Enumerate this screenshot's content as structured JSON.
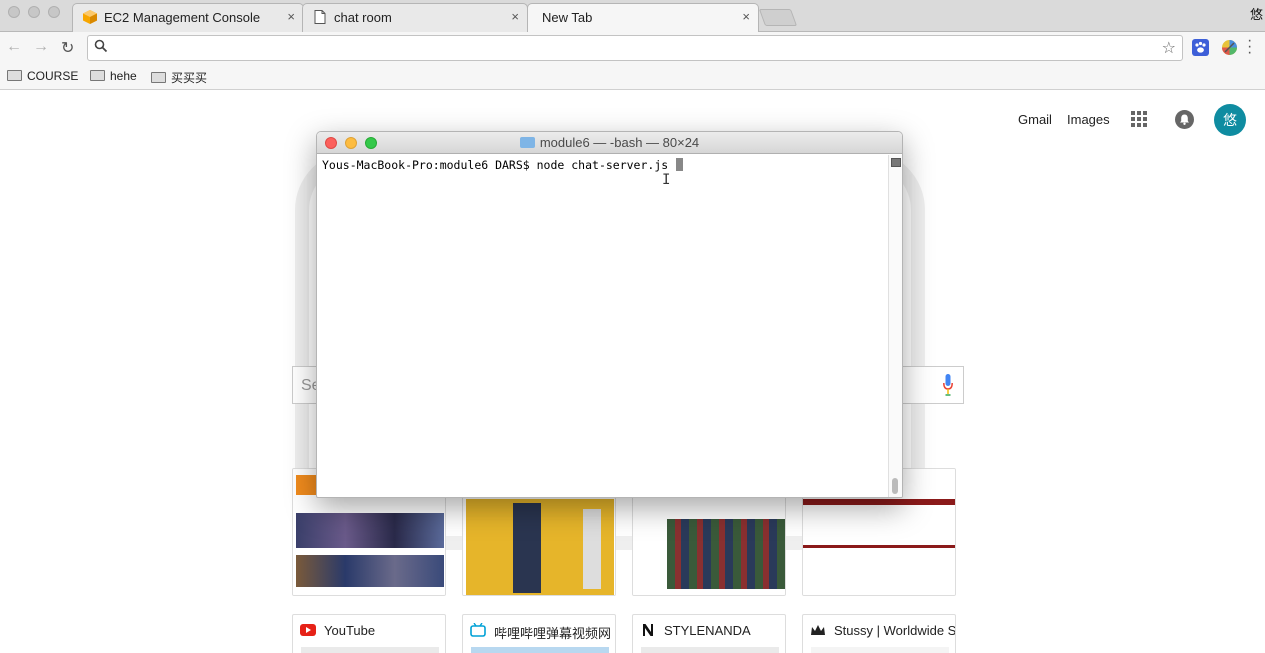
{
  "browser": {
    "profile_char": "悠",
    "tabs": [
      {
        "title": "EC2 Management Console",
        "close": "×"
      },
      {
        "title": "chat room",
        "close": "×"
      },
      {
        "title": "New Tab",
        "close": "×"
      }
    ],
    "nav": {
      "back": "←",
      "forward": "→",
      "reload": "↻"
    },
    "omnibox": {
      "value": "",
      "placeholder": ""
    },
    "bookmark_star": "☆",
    "bookmarks": [
      "COURSE",
      "hehe",
      "买买买"
    ]
  },
  "ntp": {
    "links": {
      "gmail": "Gmail",
      "images": "Images"
    },
    "avatar_char": "悠",
    "search_placeholder": "Se",
    "shortcuts": [
      {
        "title": "YouTube"
      },
      {
        "title": "哔哩哔哩弹幕视频网 -"
      },
      {
        "title": "STYLENANDA"
      },
      {
        "title": "Stussy | Worldwide Si"
      }
    ]
  },
  "terminal": {
    "title": "module6 — -bash — 80×24",
    "prompt_line": "Yous-MacBook-Pro:module6 DARS$ node chat-server.js "
  },
  "colors": {
    "avatar_bg": "#0f8ca1",
    "close_light": "#fc605c",
    "minimize_light": "#fdbc40",
    "zoom_light": "#34c84a"
  }
}
